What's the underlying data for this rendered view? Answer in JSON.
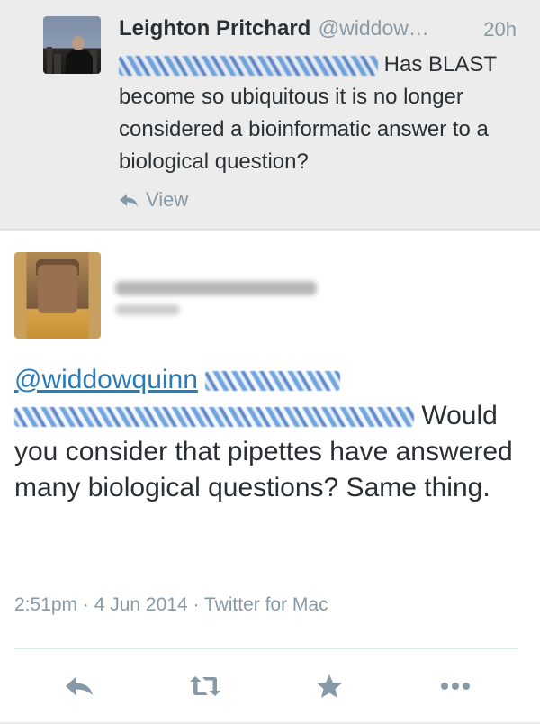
{
  "parent_tweet": {
    "author_name": "Leighton Pritchard",
    "author_handle": "@widdow…",
    "time": "20h",
    "text": "Has BLAST become so ubiquitous it is no longer considered a bioinformatic answer to a biological question?",
    "view_label": "View"
  },
  "main_tweet": {
    "mention": "@widdowquinn",
    "text": "Would you consider that pipettes have answered many biological questions? Same thing.",
    "timestamp": "2:51pm · 4 Jun 2014 · Twitter for Mac"
  },
  "actions": {
    "reply_icon": "reply-icon",
    "retweet_icon": "retweet-icon",
    "favorite_icon": "star-icon",
    "more_icon": "more-icon"
  },
  "colors": {
    "link": "#2b7bb9",
    "muted": "#8899a6",
    "text": "#292f33"
  }
}
